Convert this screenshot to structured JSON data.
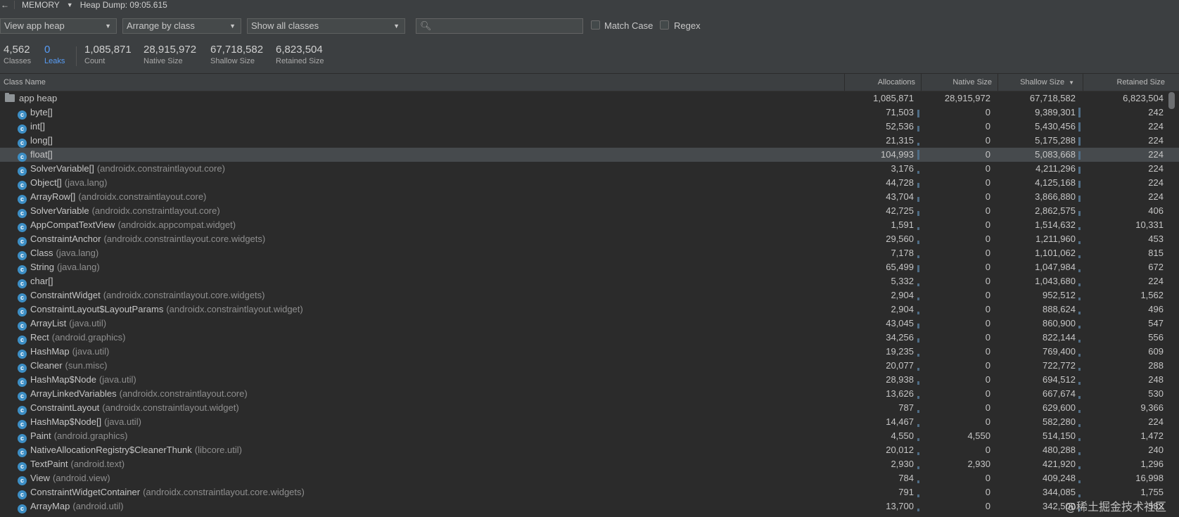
{
  "toolbar": {
    "back_icon": "←",
    "profiler": "MEMORY",
    "heap_dump": "Heap Dump: 09:05.615"
  },
  "filters": {
    "heap_select": "View app heap",
    "arrange_select": "Arrange by class",
    "classes_select": "Show all classes",
    "search_placeholder": "",
    "match_case": "Match Case",
    "regex": "Regex"
  },
  "summary": [
    {
      "value": "4,562",
      "label": "Classes"
    },
    {
      "value": "0",
      "label": "Leaks"
    },
    {
      "value": "1,085,871",
      "label": "Count"
    },
    {
      "value": "28,915,972",
      "label": "Native Size"
    },
    {
      "value": "67,718,582",
      "label": "Shallow Size"
    },
    {
      "value": "6,823,504",
      "label": "Retained Size"
    }
  ],
  "columns": [
    "Class Name",
    "Allocations",
    "Native Size",
    "Shallow Size",
    "Retained Size"
  ],
  "rows": [
    {
      "name": "app heap",
      "pkg": "",
      "alloc": "1,085,871",
      "native": "28,915,972",
      "shallow": "67,718,582",
      "retained": "6,823,504",
      "a_frac": 0,
      "s_frac": 0
    },
    {
      "name": "byte[]",
      "pkg": "",
      "alloc": "71,503",
      "native": "0",
      "shallow": "9,389,301",
      "retained": "242",
      "a_frac": 0.68,
      "s_frac": 1
    },
    {
      "name": "int[]",
      "pkg": "",
      "alloc": "52,536",
      "native": "0",
      "shallow": "5,430,456",
      "retained": "224",
      "a_frac": 0.5,
      "s_frac": 0.58
    },
    {
      "name": "long[]",
      "pkg": "",
      "alloc": "21,315",
      "native": "0",
      "shallow": "5,175,288",
      "retained": "224",
      "a_frac": 0.2,
      "s_frac": 0.55
    },
    {
      "name": "float[]",
      "pkg": "",
      "alloc": "104,993",
      "native": "0",
      "shallow": "5,083,668",
      "retained": "224",
      "a_frac": 1,
      "s_frac": 0.54
    },
    {
      "name": "SolverVariable[]",
      "pkg": "(androidx.constraintlayout.core)",
      "alloc": "3,176",
      "native": "0",
      "shallow": "4,211,296",
      "retained": "224",
      "a_frac": 0.03,
      "s_frac": 0.45
    },
    {
      "name": "Object[]",
      "pkg": "(java.lang)",
      "alloc": "44,728",
      "native": "0",
      "shallow": "4,125,168",
      "retained": "224",
      "a_frac": 0.43,
      "s_frac": 0.44
    },
    {
      "name": "ArrayRow[]",
      "pkg": "(androidx.constraintlayout.core)",
      "alloc": "43,704",
      "native": "0",
      "shallow": "3,866,880",
      "retained": "224",
      "a_frac": 0.42,
      "s_frac": 0.41
    },
    {
      "name": "SolverVariable",
      "pkg": "(androidx.constraintlayout.core)",
      "alloc": "42,725",
      "native": "0",
      "shallow": "2,862,575",
      "retained": "406",
      "a_frac": 0.41,
      "s_frac": 0.3
    },
    {
      "name": "AppCompatTextView",
      "pkg": "(androidx.appcompat.widget)",
      "alloc": "1,591",
      "native": "0",
      "shallow": "1,514,632",
      "retained": "10,331",
      "a_frac": 0.02,
      "s_frac": 0.16
    },
    {
      "name": "ConstraintAnchor",
      "pkg": "(androidx.constraintlayout.core.widgets)",
      "alloc": "29,560",
      "native": "0",
      "shallow": "1,211,960",
      "retained": "453",
      "a_frac": 0.28,
      "s_frac": 0.13
    },
    {
      "name": "Class",
      "pkg": "(java.lang)",
      "alloc": "7,178",
      "native": "0",
      "shallow": "1,101,062",
      "retained": "815",
      "a_frac": 0.07,
      "s_frac": 0.12
    },
    {
      "name": "String",
      "pkg": "(java.lang)",
      "alloc": "65,499",
      "native": "0",
      "shallow": "1,047,984",
      "retained": "672",
      "a_frac": 0.62,
      "s_frac": 0.11
    },
    {
      "name": "char[]",
      "pkg": "",
      "alloc": "5,332",
      "native": "0",
      "shallow": "1,043,680",
      "retained": "224",
      "a_frac": 0.05,
      "s_frac": 0.11
    },
    {
      "name": "ConstraintWidget",
      "pkg": "(androidx.constraintlayout.core.widgets)",
      "alloc": "2,904",
      "native": "0",
      "shallow": "952,512",
      "retained": "1,562",
      "a_frac": 0.03,
      "s_frac": 0.1
    },
    {
      "name": "ConstraintLayout$LayoutParams",
      "pkg": "(androidx.constraintlayout.widget)",
      "alloc": "2,904",
      "native": "0",
      "shallow": "888,624",
      "retained": "496",
      "a_frac": 0.03,
      "s_frac": 0.09
    },
    {
      "name": "ArrayList",
      "pkg": "(java.util)",
      "alloc": "43,045",
      "native": "0",
      "shallow": "860,900",
      "retained": "547",
      "a_frac": 0.41,
      "s_frac": 0.09
    },
    {
      "name": "Rect",
      "pkg": "(android.graphics)",
      "alloc": "34,256",
      "native": "0",
      "shallow": "822,144",
      "retained": "556",
      "a_frac": 0.33,
      "s_frac": 0.09
    },
    {
      "name": "HashMap",
      "pkg": "(java.util)",
      "alloc": "19,235",
      "native": "0",
      "shallow": "769,400",
      "retained": "609",
      "a_frac": 0.18,
      "s_frac": 0.08
    },
    {
      "name": "Cleaner",
      "pkg": "(sun.misc)",
      "alloc": "20,077",
      "native": "0",
      "shallow": "722,772",
      "retained": "288",
      "a_frac": 0.19,
      "s_frac": 0.08
    },
    {
      "name": "HashMap$Node",
      "pkg": "(java.util)",
      "alloc": "28,938",
      "native": "0",
      "shallow": "694,512",
      "retained": "248",
      "a_frac": 0.28,
      "s_frac": 0.07
    },
    {
      "name": "ArrayLinkedVariables",
      "pkg": "(androidx.constraintlayout.core)",
      "alloc": "13,626",
      "native": "0",
      "shallow": "667,674",
      "retained": "530",
      "a_frac": 0.13,
      "s_frac": 0.07
    },
    {
      "name": "ConstraintLayout",
      "pkg": "(androidx.constraintlayout.widget)",
      "alloc": "787",
      "native": "0",
      "shallow": "629,600",
      "retained": "9,366",
      "a_frac": 0.01,
      "s_frac": 0.07
    },
    {
      "name": "HashMap$Node[]",
      "pkg": "(java.util)",
      "alloc": "14,467",
      "native": "0",
      "shallow": "582,280",
      "retained": "224",
      "a_frac": 0.14,
      "s_frac": 0.06
    },
    {
      "name": "Paint",
      "pkg": "(android.graphics)",
      "alloc": "4,550",
      "native": "4,550",
      "shallow": "514,150",
      "retained": "1,472",
      "a_frac": 0.04,
      "s_frac": 0.05
    },
    {
      "name": "NativeAllocationRegistry$CleanerThunk",
      "pkg": "(libcore.util)",
      "alloc": "20,012",
      "native": "0",
      "shallow": "480,288",
      "retained": "240",
      "a_frac": 0.19,
      "s_frac": 0.05
    },
    {
      "name": "TextPaint",
      "pkg": "(android.text)",
      "alloc": "2,930",
      "native": "2,930",
      "shallow": "421,920",
      "retained": "1,296",
      "a_frac": 0.03,
      "s_frac": 0.04
    },
    {
      "name": "View",
      "pkg": "(android.view)",
      "alloc": "784",
      "native": "0",
      "shallow": "409,248",
      "retained": "16,998",
      "a_frac": 0.01,
      "s_frac": 0.04
    },
    {
      "name": "ConstraintWidgetContainer",
      "pkg": "(androidx.constraintlayout.core.widgets)",
      "alloc": "791",
      "native": "0",
      "shallow": "344,085",
      "retained": "1,755",
      "a_frac": 0.01,
      "s_frac": 0.04
    },
    {
      "name": "ArrayMap",
      "pkg": "(android.util)",
      "alloc": "13,700",
      "native": "0",
      "shallow": "342,500",
      "retained": "582",
      "a_frac": 0.13,
      "s_frac": 0.04
    }
  ],
  "watermark": "@稀土掘金技术社区",
  "colors": {
    "accent": "#589df6",
    "class_icon": "#3d8ec4",
    "bar": "#4f6d86"
  }
}
